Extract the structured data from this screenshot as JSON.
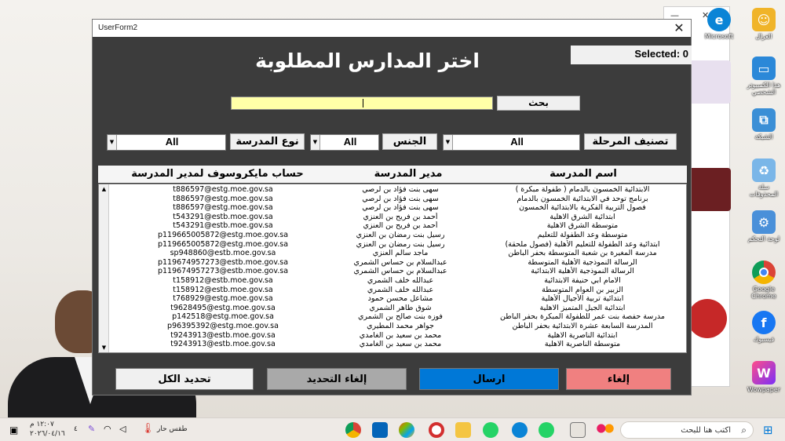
{
  "form": {
    "title": "UserForm2",
    "heading": "اختر المدارس المطلوبة",
    "selected_text": "Selected: 0",
    "search_button": "بحث",
    "search_value": "",
    "filters": {
      "stage_label": "تصنيف المرحلة",
      "stage_value": "All",
      "gender_label": "الجنس",
      "gender_value": "All",
      "type_label": "نوع المدرسة",
      "type_value": "All"
    },
    "columns": {
      "school": "اسم المدرسة",
      "manager": "مدير المدرسة",
      "email": "حساب مايكروسوف لمدير المدرسة"
    },
    "rows": [
      {
        "school": "الابتدائية الخمسون بالدمام ( طفولة مبكرة )",
        "manager": "سهى بنت فؤاد بن لرصي",
        "email": "t886597@estg.moe.gov.sa"
      },
      {
        "school": "برنامج  توحد في الابتدائية الخمسون  بالدمام",
        "manager": "سهى بنت فؤاد بن لرصي",
        "email": "t886597@estg.moe.gov.sa"
      },
      {
        "school": "فصول التربية الفكرية بالابتدائية الخمسون",
        "manager": "سهى بنت فؤاد بن لرصي",
        "email": "t886597@estg.moe.gov.sa"
      },
      {
        "school": "ابتدائية الشرق الاهلية",
        "manager": "أحمد بن فريح بن العنزي",
        "email": "t543291@estb.moe.gov.sa"
      },
      {
        "school": "متوسطة الشرق الاهلية",
        "manager": "أحمد بن فريح بن العنزي",
        "email": "t543291@estb.moe.gov.sa"
      },
      {
        "school": "متوسطة وعد الطفولة للتعليم",
        "manager": "رسيل بنت رمضان بن العنزي",
        "email": "p119665005872@estg.moe.gov.sa"
      },
      {
        "school": "ابتدائية وعد الطفولة للتعليم الأهلية (فصول ملحقة)",
        "manager": "رسيل بنت رمضان بن العنزي",
        "email": "p119665005872@estg.moe.gov.sa"
      },
      {
        "school": "مدرسة المغيرة بن شعبة المتوسطة بحفر الباطن",
        "manager": "ماجد سالم العنزي",
        "email": "sp948860@estb.moe.gov.sa"
      },
      {
        "school": "الرسالة النموذجية الأهلية المتوسطة",
        "manager": "عبدالسلام بن حساس الشمري",
        "email": "p119674957273@estb.moe.gov.sa"
      },
      {
        "school": "الرسالة النموذجية الأهلية الابتدائية",
        "manager": "عبدالسلام بن حساس الشمري",
        "email": "p119674957273@estb.moe.gov.sa"
      },
      {
        "school": "الامام ابي حنيفة الابتدائية",
        "manager": "عبدالله خلف الشمري",
        "email": "t158912@estb.moe.gov.sa"
      },
      {
        "school": "الزبير بن العوام المتوسطة",
        "manager": "عبدالله خلف الشمري",
        "email": "t158912@estb.moe.gov.sa"
      },
      {
        "school": "ابتدائية تربية الأجيال الأهلية",
        "manager": "مشاعل محسن حمود",
        "email": "t768929@estg.moe.gov.sa"
      },
      {
        "school": "ابتدائية الجيل المتميز الاهلية",
        "manager": "شوق طاهر الشمري",
        "email": "t9628495@estg.moe.gov.sa"
      },
      {
        "school": "مدرسة حفصة بنت عمر للطفولة المبكرة بحفر الباطن",
        "manager": "فوزه بنت صالح بن الشمري",
        "email": "p142518@estg.moe.gov.sa"
      },
      {
        "school": "المدرسة السابعة عشرة الابتدائية بحفر الباطن",
        "manager": "جواهر محمد المطيري",
        "email": "p96395392@estg.moe.gov.sa"
      },
      {
        "school": "ابتدائية الناصرية الاهلية",
        "manager": "محمد بن سعيد بن الغامدي",
        "email": "t9243913@estb.moe.gov.sa"
      },
      {
        "school": "متوسطة الناصرية الاهلية",
        "manager": "محمد بن سعيد بن الغامدي",
        "email": "t9243913@estb.moe.gov.sa"
      }
    ],
    "buttons": {
      "cancel": "إلغاء",
      "send": "ارسال",
      "deselect": "إلغاء التحديد",
      "select_all": "تحديد الكل"
    }
  },
  "desktop": {
    "icons": [
      {
        "name": "microsoft-edge",
        "label": "Microsoft"
      },
      {
        "name": "user-folder",
        "label": "الغزال"
      },
      {
        "name": "this-pc",
        "label": "هذا الكمبيوتر الشخصي"
      },
      {
        "name": "network",
        "label": "الشبكة"
      },
      {
        "name": "recycle-bin",
        "label": "سلة المحذوفات"
      },
      {
        "name": "control-panel",
        "label": "لوحة التحكم"
      },
      {
        "name": "google-chrome",
        "label": "Google Chrome"
      },
      {
        "name": "facebook",
        "label": "فيسبوك"
      },
      {
        "name": "wowpaper",
        "label": "Wowpaper"
      }
    ]
  },
  "taskbar": {
    "time": "١٢:٠٧ م",
    "date": "٢٠٢٦/٠٤/١٦",
    "weather": "طقس حار",
    "badge_count": "٤",
    "search_placeholder": "اكتب هنا للبحث"
  },
  "colors": {
    "form_bg": "#3c3c3c",
    "search_bg": "#ffffa8",
    "cancel": "#f08080",
    "send": "#0078d7",
    "deselect": "#a9a9a9",
    "select_all": "#f0f0f0"
  }
}
